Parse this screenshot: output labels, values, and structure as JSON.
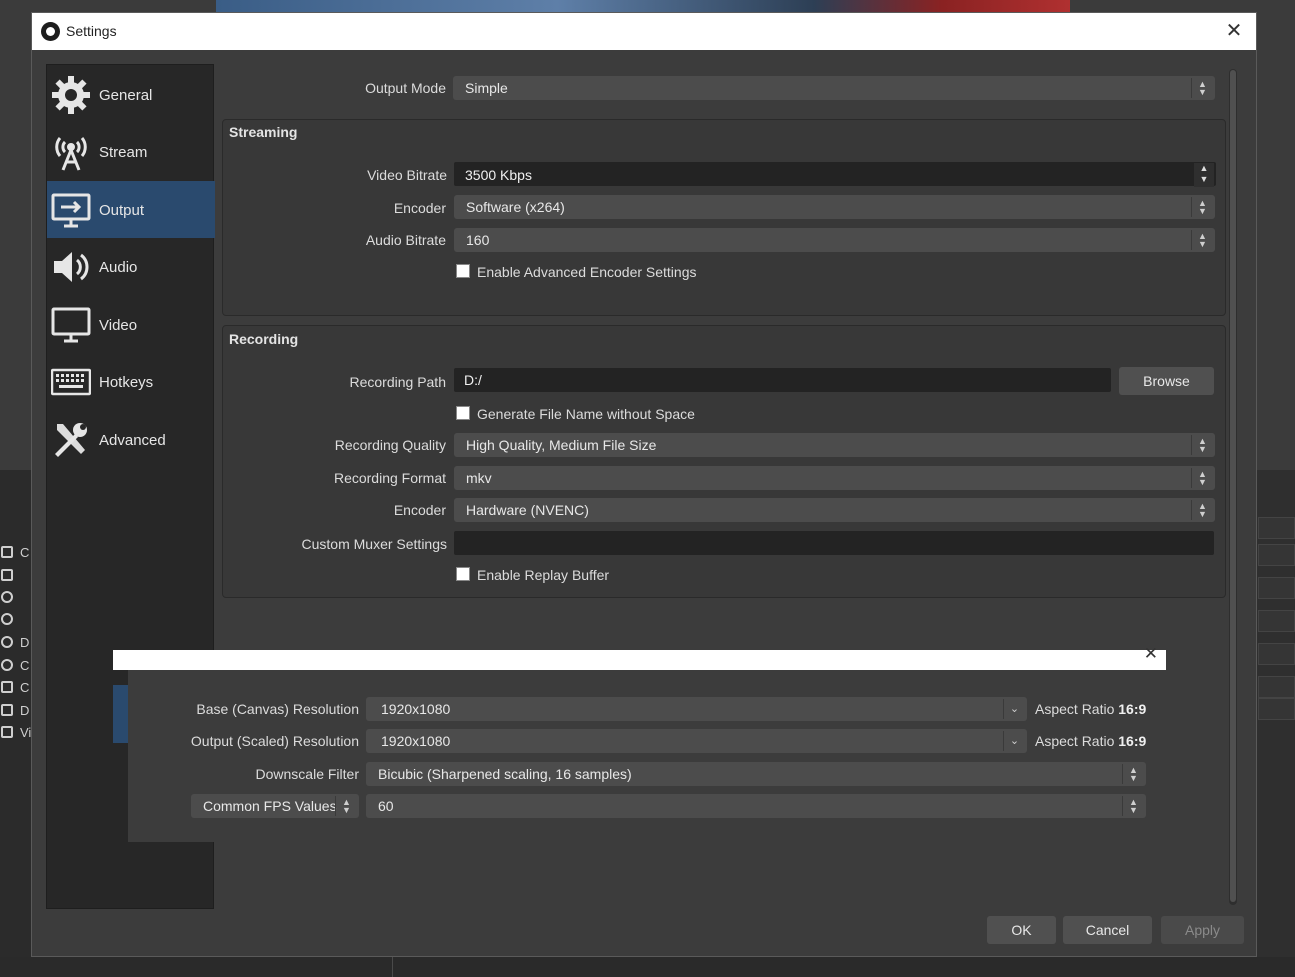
{
  "window": {
    "title": "Settings"
  },
  "sidebar": {
    "items": [
      {
        "label": "General",
        "icon": "gear-icon"
      },
      {
        "label": "Stream",
        "icon": "antenna-icon"
      },
      {
        "label": "Output",
        "icon": "monitor-output-icon",
        "active": true
      },
      {
        "label": "Audio",
        "icon": "speaker-icon"
      },
      {
        "label": "Video",
        "icon": "monitor-icon"
      },
      {
        "label": "Hotkeys",
        "icon": "keyboard-icon"
      },
      {
        "label": "Advanced",
        "icon": "tools-icon"
      }
    ]
  },
  "output": {
    "mode_label": "Output Mode",
    "mode_value": "Simple",
    "streaming": {
      "title": "Streaming",
      "video_bitrate_label": "Video Bitrate",
      "video_bitrate_value": "3500 Kbps",
      "encoder_label": "Encoder",
      "encoder_value": "Software (x264)",
      "audio_bitrate_label": "Audio Bitrate",
      "audio_bitrate_value": "160",
      "advanced_checkbox_label": "Enable Advanced Encoder Settings"
    },
    "recording": {
      "title": "Recording",
      "path_label": "Recording Path",
      "path_value": "D:/",
      "browse_label": "Browse",
      "nospace_label": "Generate File Name without Space",
      "quality_label": "Recording Quality",
      "quality_value": "High Quality, Medium File Size",
      "format_label": "Recording Format",
      "format_value": "mkv",
      "encoder_label": "Encoder",
      "encoder_value": "Hardware (NVENC)",
      "muxer_label": "Custom Muxer Settings",
      "muxer_value": "",
      "replay_label": "Enable Replay Buffer"
    }
  },
  "video_overlay": {
    "base_label": "Base (Canvas) Resolution",
    "base_value": "1920x1080",
    "output_label": "Output (Scaled) Resolution",
    "output_value": "1920x1080",
    "aspect_prefix": "Aspect Ratio",
    "aspect_value": "16:9",
    "filter_label": "Downscale Filter",
    "filter_value": "Bicubic (Sharpened scaling, 16 samples)",
    "fps_type_value": "Common FPS Values",
    "fps_value": "60"
  },
  "footer": {
    "ok": "OK",
    "cancel": "Cancel",
    "apply": "Apply"
  },
  "background_left_items": [
    "C",
    "",
    "",
    "",
    "D",
    "C",
    "C",
    "D",
    "Vi"
  ],
  "colors": {
    "accent": "#2a4a6e",
    "window_bg": "#3c3c3c",
    "sidebar_bg": "#272727",
    "field_bg": "#4c4c4c"
  }
}
